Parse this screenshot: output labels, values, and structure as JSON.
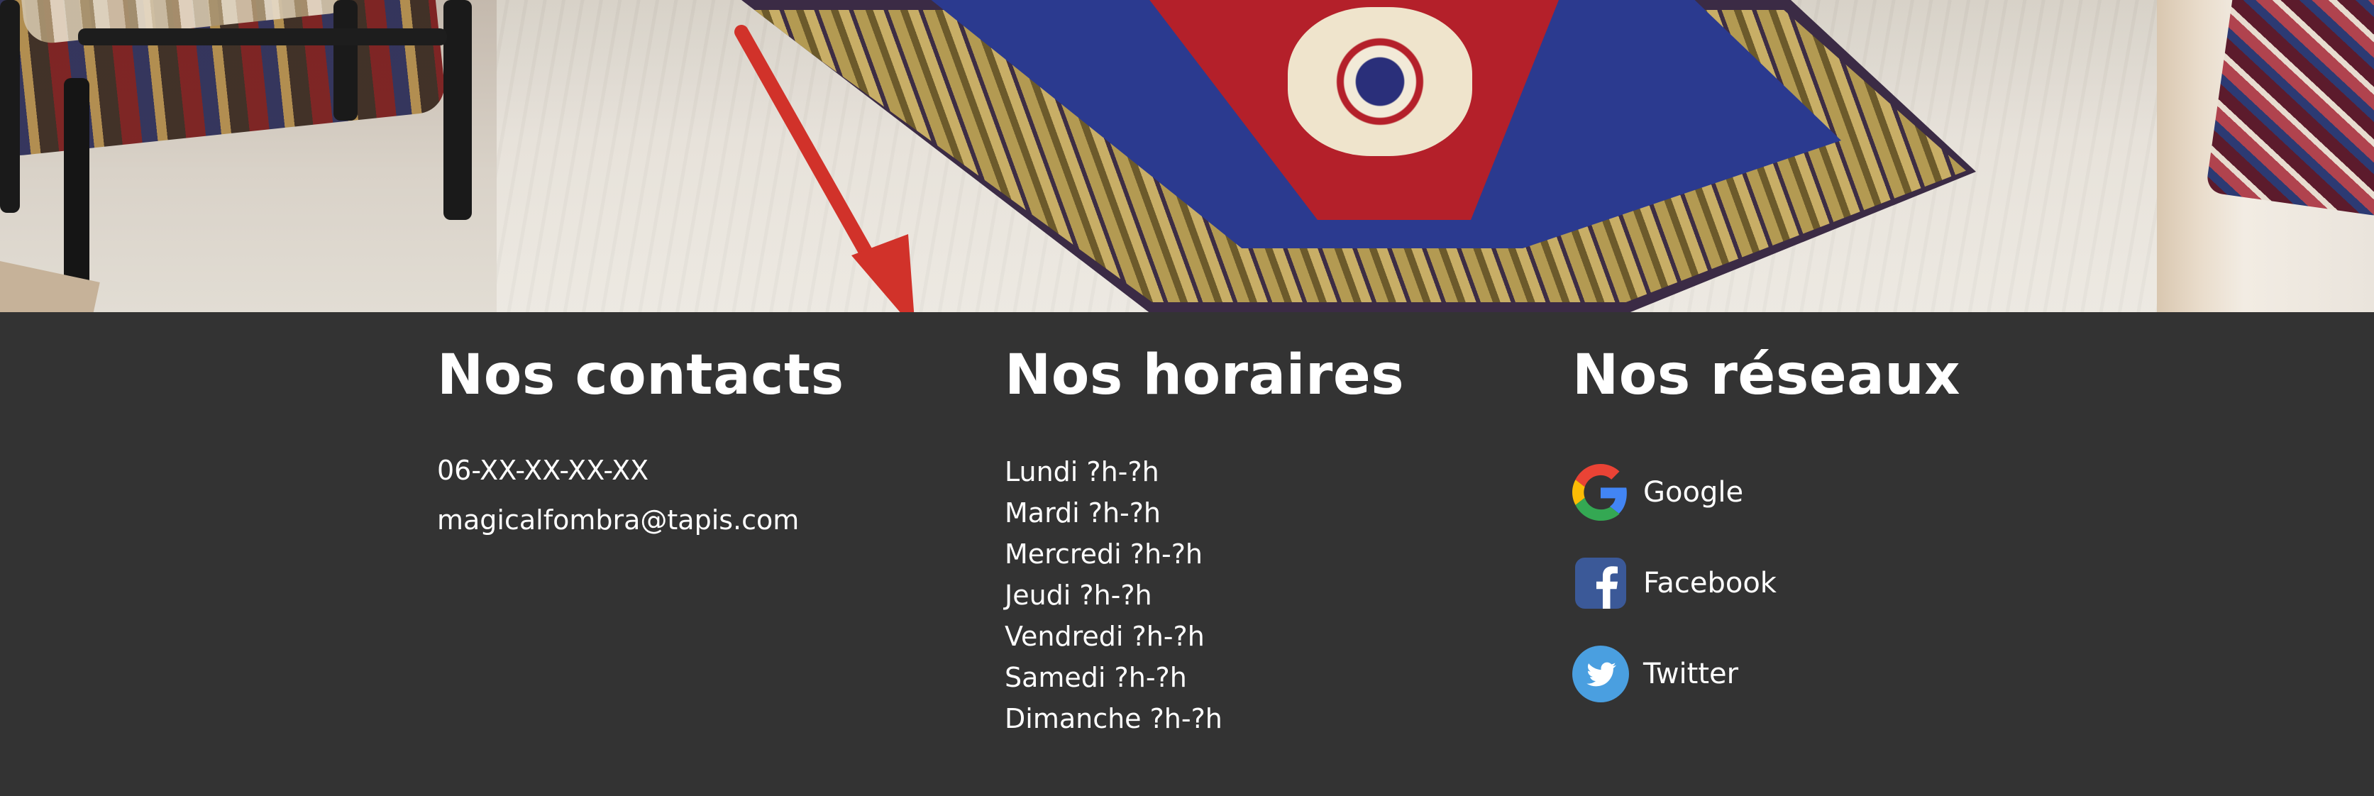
{
  "footer": {
    "contacts": {
      "title": "Nos contacts",
      "phone": "06-XX-XX-XX-XX",
      "email": "magicalfombra@tapis.com"
    },
    "hours": {
      "title": "Nos horaires",
      "days": [
        "Lundi ?h-?h",
        "Mardi ?h-?h",
        "Mercredi ?h-?h",
        "Jeudi ?h-?h",
        "Vendredi ?h-?h",
        "Samedi ?h-?h",
        "Dimanche ?h-?h"
      ]
    },
    "social": {
      "title": "Nos réseaux",
      "links": [
        {
          "label": "Google",
          "icon": "google-icon"
        },
        {
          "label": "Facebook",
          "icon": "facebook-icon"
        },
        {
          "label": "Twitter",
          "icon": "twitter-icon"
        }
      ]
    }
  },
  "colors": {
    "footer_background": "#333333",
    "text": "#ffffff",
    "annotation_arrow": "#d1322a",
    "facebook": "#3b5998",
    "twitter": "#4a9fe0"
  }
}
